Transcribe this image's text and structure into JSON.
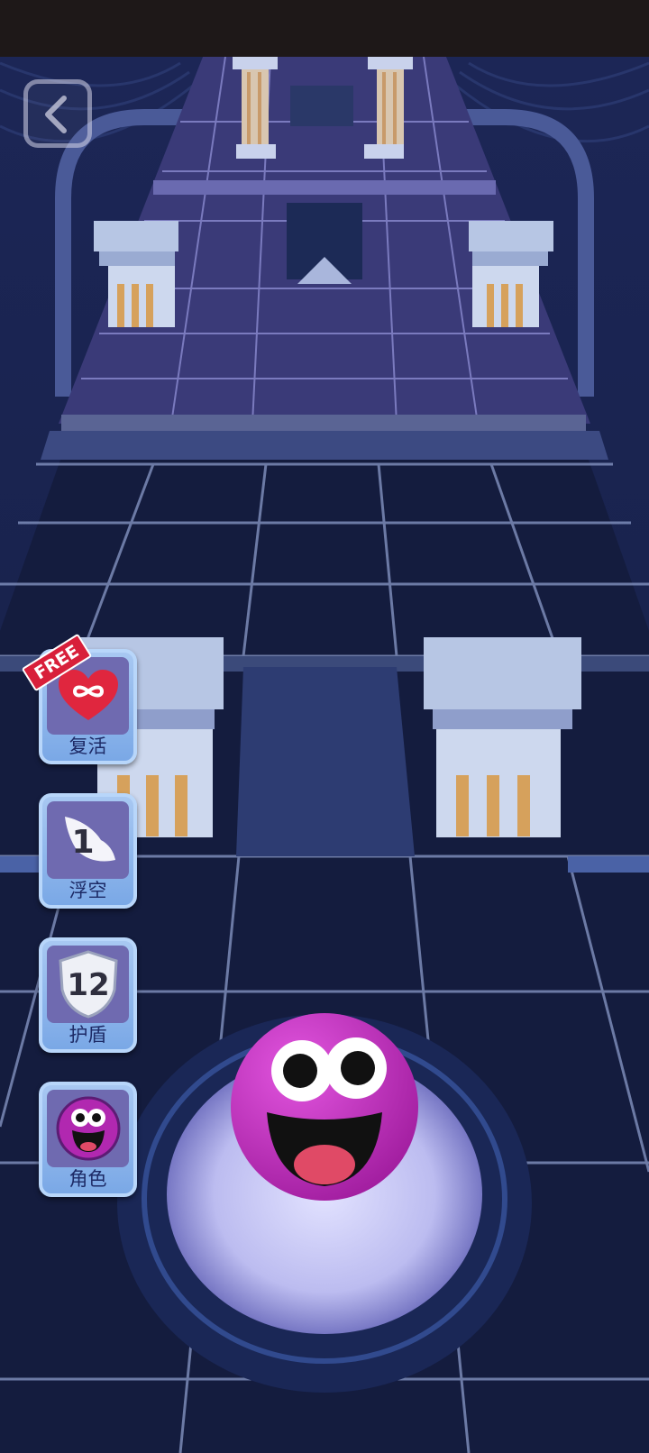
{
  "hud": {
    "back_icon": "chevron-left-icon"
  },
  "powerups": [
    {
      "id": "revive",
      "label": "复活",
      "icon": "infinity-heart-icon",
      "badge": "FREE"
    },
    {
      "id": "float",
      "label": "浮空",
      "icon": "wing-icon",
      "count": "1"
    },
    {
      "id": "shield",
      "label": "护盾",
      "icon": "shield-icon",
      "count": "12"
    },
    {
      "id": "character",
      "label": "角色",
      "icon": "purple-ball-face-icon"
    }
  ],
  "colors": {
    "floor": "#141c3e",
    "grid_line": "#8a9ac8",
    "temple_floor": "#3a3a78",
    "pillar": "#b7c6e4",
    "pillar_stripe": "#d6a15c",
    "ball": "#c22fbf",
    "pad_glow": "#d9d9ff"
  }
}
